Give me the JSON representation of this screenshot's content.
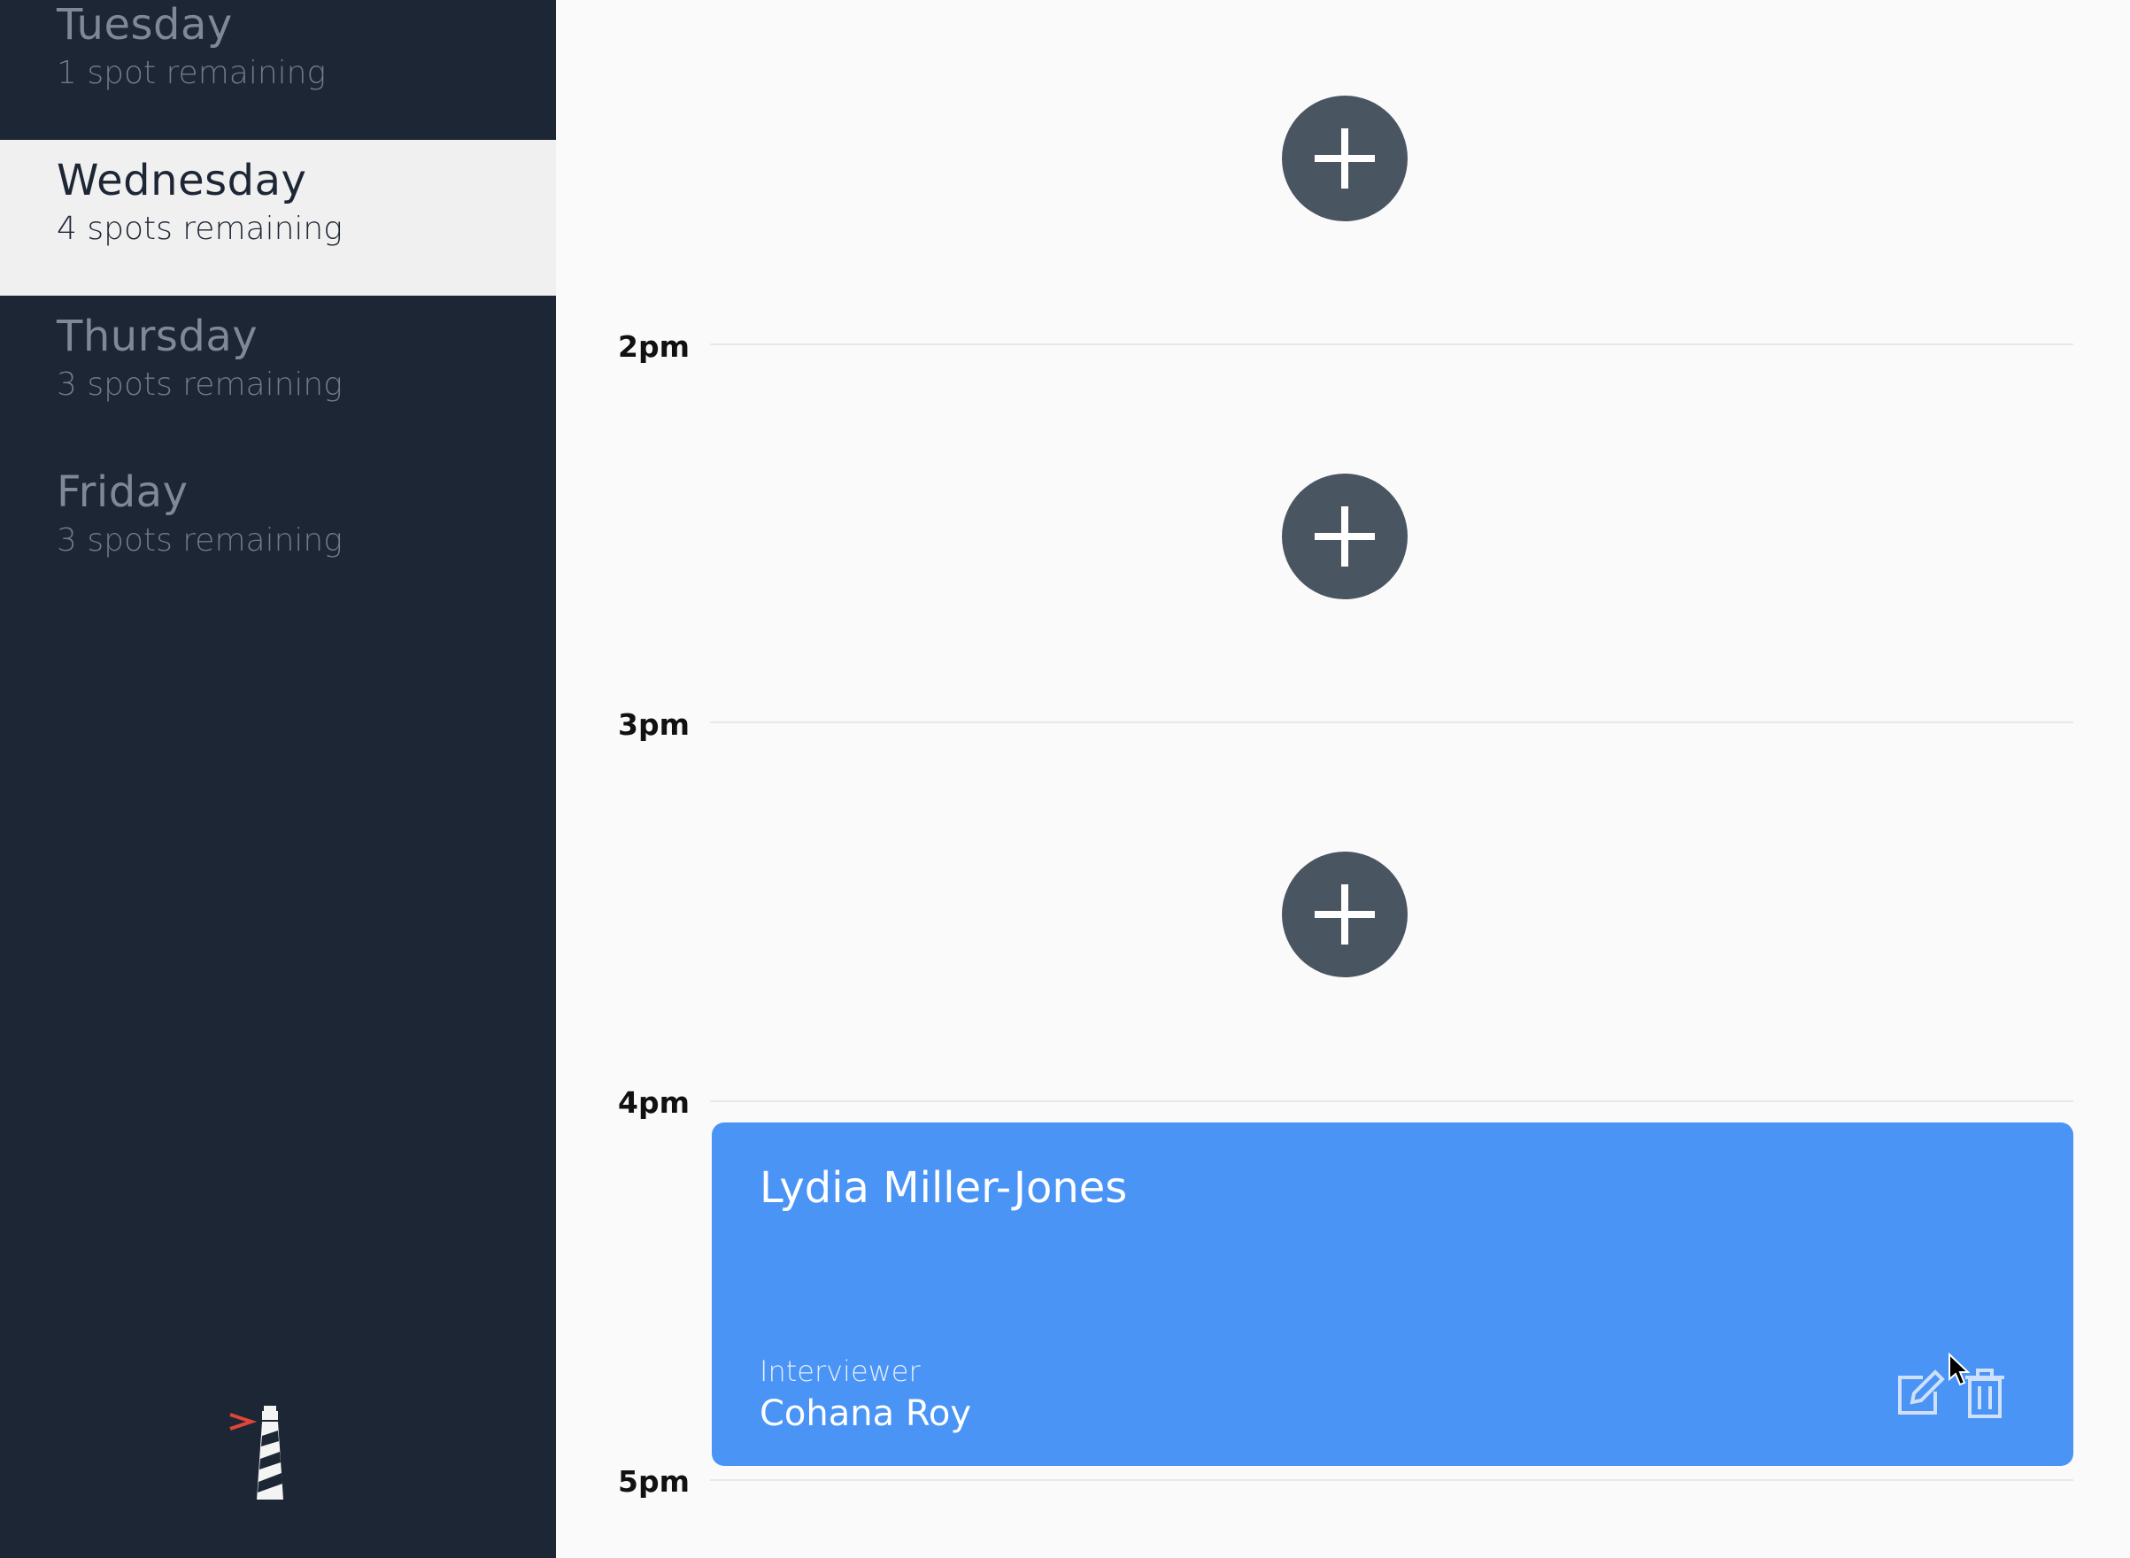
{
  "sidebar": {
    "days": [
      {
        "name": "Tuesday",
        "spots": "1 spot remaining",
        "selected": false
      },
      {
        "name": "Wednesday",
        "spots": "4 spots remaining",
        "selected": true
      },
      {
        "name": "Thursday",
        "spots": "3 spots remaining",
        "selected": false
      },
      {
        "name": "Friday",
        "spots": "3 spots remaining",
        "selected": false
      }
    ],
    "logo_icon": "lighthouse-logo"
  },
  "schedule": {
    "hours": [
      "2pm",
      "3pm",
      "4pm",
      "5pm"
    ],
    "add_slots": [
      {
        "icon": "plus-icon"
      },
      {
        "icon": "plus-icon"
      },
      {
        "icon": "plus-icon"
      }
    ],
    "appointment": {
      "student": "Lydia Miller-Jones",
      "interviewer_label": "Interviewer",
      "interviewer": "Cohana Roy",
      "edit_icon": "edit-icon",
      "delete_icon": "trash-icon"
    }
  },
  "colors": {
    "sidebar_bg": "#1c2634",
    "selected_day_bg": "#f0f0f0",
    "appointment_bg": "#4a94f6",
    "add_button_bg": "#4a5562",
    "logo_accent": "#e0453a"
  }
}
